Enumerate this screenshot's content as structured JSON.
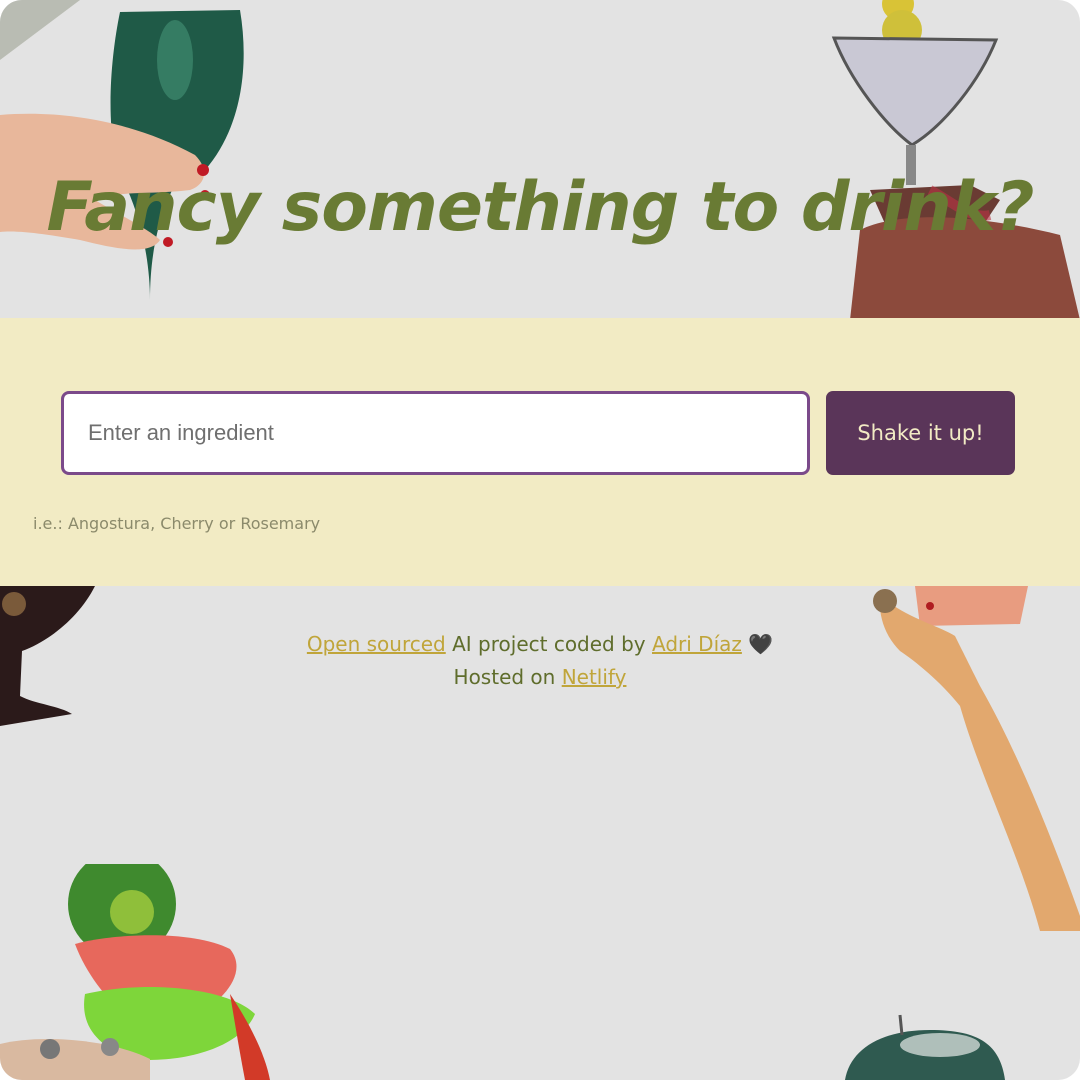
{
  "title": "Fancy something to drink?",
  "search": {
    "placeholder": "Enter an ingredient",
    "button_label": "Shake it up!",
    "hint": "i.e.: Angostura, Cherry or Rosemary"
  },
  "footer": {
    "open_source_link": "Open sourced",
    "text_coded_by": " AI project coded by ",
    "author_link": "Adri Díaz",
    "heart": " 🖤",
    "hosted_text": "Hosted on ",
    "host_link": "Netlify"
  },
  "colors": {
    "background": "#e3e3e3",
    "title": "#697b34",
    "band": "#f2ebc4",
    "button": "#5a3559",
    "input_border": "#7b4a8a",
    "link": "#c0a53a"
  },
  "decorations": [
    "wine-glass-hand-image",
    "martini-olives-image",
    "cocktail-hand-image",
    "raised-glass-arm-image",
    "kiwi-cocktail-image",
    "ice-bucket-image"
  ]
}
